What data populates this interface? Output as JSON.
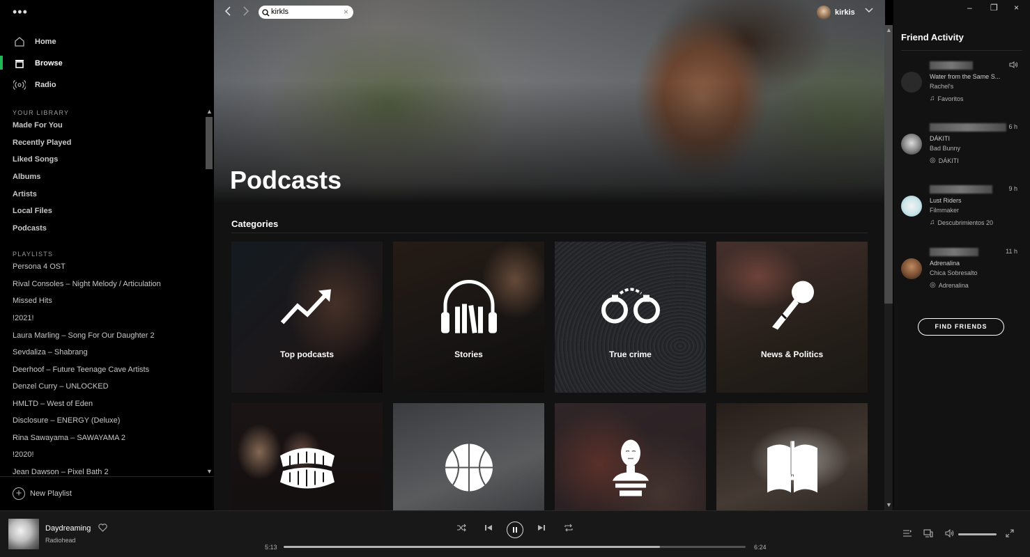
{
  "sidebar": {
    "nav": [
      {
        "label": "Home",
        "icon": "home-icon"
      },
      {
        "label": "Browse",
        "icon": "browse-icon",
        "active": true
      },
      {
        "label": "Radio",
        "icon": "radio-icon"
      }
    ],
    "library_title": "YOUR LIBRARY",
    "library": [
      "Made For You",
      "Recently Played",
      "Liked Songs",
      "Albums",
      "Artists",
      "Local Files",
      "Podcasts"
    ],
    "playlists_title": "PLAYLISTS",
    "playlists": [
      "Persona 4 OST",
      "Rival Consoles – Night Melody / Articulation",
      "Missed Hits",
      "!2021!",
      "Laura Marling – Song For Our Daughter 2",
      "Sevdaliza – Shabrang",
      "Deerhoof – Future Teenage Cave Artists",
      "Denzel Curry – UNLOCKED",
      "HMLTD – West of Eden",
      "Disclosure – ENERGY (Deluxe)",
      "Rina Sawayama – SAWAYAMA 2",
      "!2020!",
      "Jean Dawson – Pixel Bath 2"
    ],
    "new_playlist": "New Playlist"
  },
  "topbar": {
    "search_value": "kirkls",
    "user_name": "kirkis"
  },
  "main": {
    "title": "Podcasts",
    "categories_title": "Categories",
    "categories": [
      {
        "label": "Top podcasts",
        "icon": "trending-up-icon"
      },
      {
        "label": "Stories",
        "icon": "headphones-books-icon"
      },
      {
        "label": "True crime",
        "icon": "handcuffs-icon"
      },
      {
        "label": "News & Politics",
        "icon": "microphone-icon"
      },
      {
        "label": "",
        "icon": "teeth-icon"
      },
      {
        "label": "",
        "icon": "basketball-icon"
      },
      {
        "label": "",
        "icon": "bust-icon"
      },
      {
        "label": "",
        "icon": "book-icon"
      }
    ]
  },
  "friend_activity": {
    "title": "Friend Activity",
    "friends": [
      {
        "time": "",
        "track": "Water from the Same S...",
        "artist": "Rachel's",
        "context": "Favoritos",
        "context_icon": "music-note-icon",
        "playing": true
      },
      {
        "time": "6 h",
        "track": "DÁKITI",
        "artist": "Bad Bunny",
        "context": "DÁKITI",
        "context_icon": "album-icon"
      },
      {
        "time": "9 h",
        "track": "Lust Riders",
        "artist": "Filmmaker",
        "context": "Descubrimientos 20",
        "context_icon": "music-note-icon"
      },
      {
        "time": "11 h",
        "track": "Adrenalina",
        "artist": "Chica Sobresalto",
        "context": "Adrenalina",
        "context_icon": "album-icon"
      }
    ],
    "find_friends": "FIND FRIENDS"
  },
  "player": {
    "track": "Daydreaming",
    "artist": "Radiohead",
    "time_current": "5:13",
    "time_total": "6:24",
    "progress": 0.815,
    "volume": 1.0
  },
  "colors": {
    "accent": "#1db954",
    "background": "#121212",
    "sidebar": "#000000",
    "player": "#181818"
  }
}
